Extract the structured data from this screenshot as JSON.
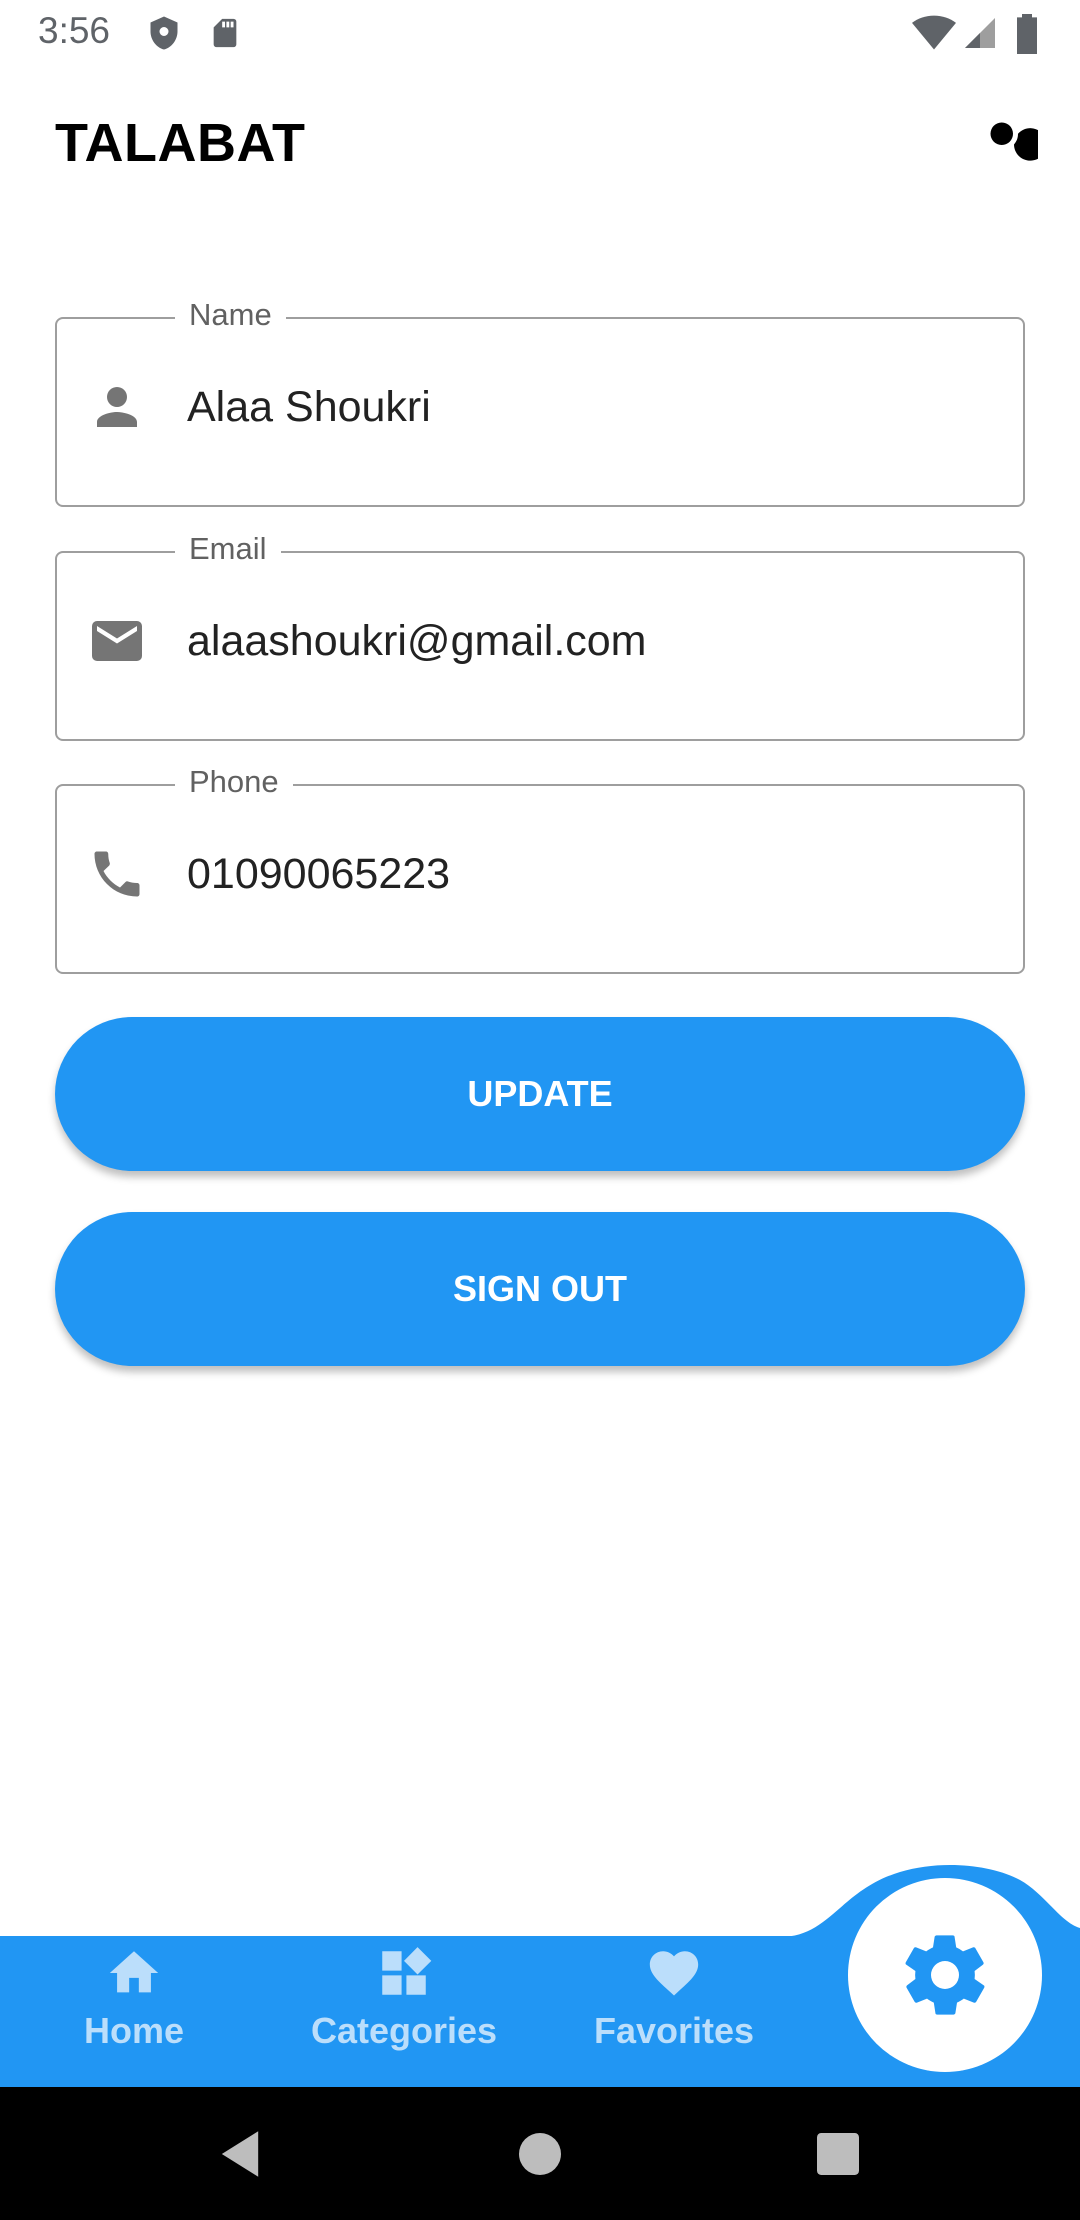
{
  "status_bar": {
    "time": "3:56",
    "icons": [
      "shield-icon",
      "sd-card-icon",
      "wifi-icon",
      "signal-icon",
      "battery-icon"
    ]
  },
  "app_bar": {
    "title": "TALABAT",
    "search_icon": "search-icon"
  },
  "form": {
    "name": {
      "label": "Name",
      "value": "Alaa Shoukri",
      "icon": "person-icon"
    },
    "email": {
      "label": "Email",
      "value": "alaashoukri@gmail.com",
      "icon": "mail-icon"
    },
    "phone": {
      "label": "Phone",
      "value": "01090065223",
      "icon": "phone-icon"
    }
  },
  "buttons": {
    "update": "UPDATE",
    "sign_out": "SIGN OUT"
  },
  "bottom_nav": {
    "items": [
      {
        "label": "Home",
        "icon": "home-icon"
      },
      {
        "label": "Categories",
        "icon": "categories-icon"
      },
      {
        "label": "Favorites",
        "icon": "heart-icon"
      }
    ],
    "active_icon": "gear-icon"
  },
  "colors": {
    "primary": "#2196f3",
    "nav_inactive": "#bbdefb",
    "field_border": "#9e9e9e",
    "icon_gray": "#757575"
  }
}
